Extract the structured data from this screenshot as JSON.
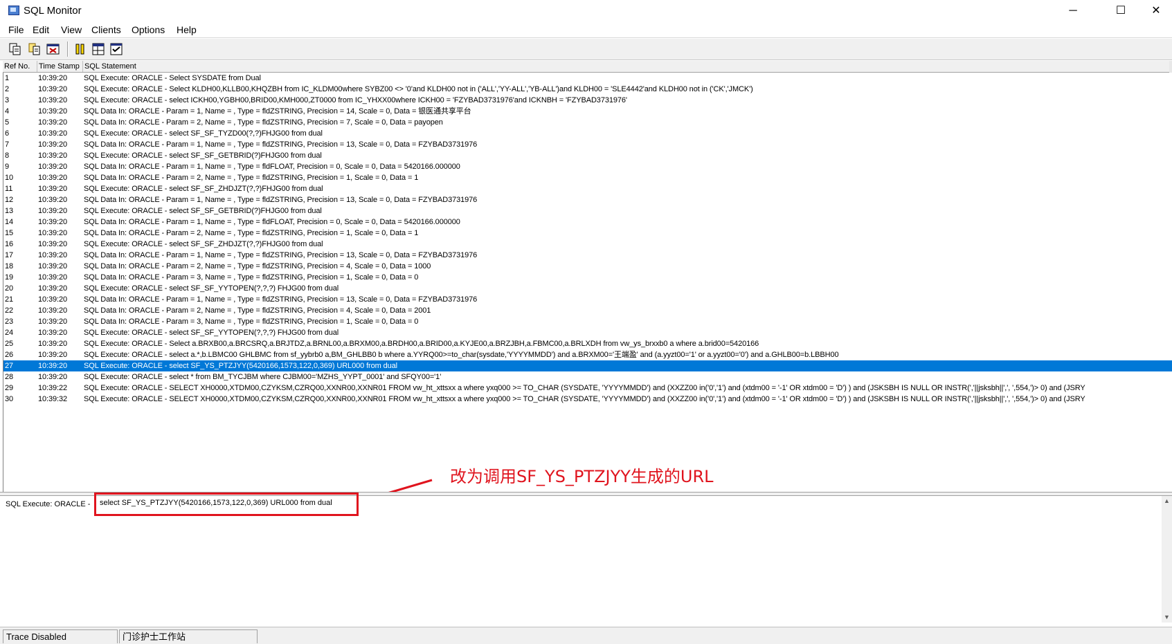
{
  "window": {
    "title": "SQL Monitor",
    "controls": {
      "minimize": "─",
      "maximize": "☐",
      "close": "✕"
    }
  },
  "menu": [
    {
      "label": "File"
    },
    {
      "label": "Edit"
    },
    {
      "label": "View"
    },
    {
      "label": "Clients"
    },
    {
      "label": "Options"
    },
    {
      "label": "Help"
    }
  ],
  "toolbar": {
    "buttons": [
      "save-log-icon",
      "copy-icon",
      "clear-icon",
      "pause-icon",
      "split-view-icon",
      "options-icon"
    ]
  },
  "columns": {
    "ref": "Ref No.",
    "time": "Time Stamp",
    "stmt": "SQL Statement"
  },
  "rows": [
    {
      "ref": "1",
      "time": "10:39:20",
      "stmt": "SQL Execute: ORACLE - Select SYSDATE from Dual"
    },
    {
      "ref": "2",
      "time": "10:39:20",
      "stmt": "SQL Execute: ORACLE - Select KLDH00,KLLB00,KHQZBH from IC_KLDM00where SYBZ00 <> '0'and KLDH00 not in ('ALL','YY-ALL','YB-ALL')and KLDH00 = 'SLE4442'and KLDH00 not in ('CK','JMCK')"
    },
    {
      "ref": "3",
      "time": "10:39:20",
      "stmt": "SQL Execute: ORACLE - select ICKH00,YGBH00,BRID00,KMH000,ZT0000 from IC_YHXX00where ICKH00 = 'FZYBAD3731976'and ICKNBH = 'FZYBAD3731976'"
    },
    {
      "ref": "4",
      "time": "10:39:20",
      "stmt": "SQL Data In: ORACLE - Param = 1, Name = , Type = fldZSTRING, Precision = 14, Scale = 0, Data = 银医通共享平台"
    },
    {
      "ref": "5",
      "time": "10:39:20",
      "stmt": "SQL Data In: ORACLE - Param = 2, Name = , Type = fldZSTRING, Precision = 7, Scale = 0, Data = payopen"
    },
    {
      "ref": "6",
      "time": "10:39:20",
      "stmt": "SQL Execute: ORACLE -  select SF_SF_TYZD00(?,?)FHJG00 from dual"
    },
    {
      "ref": "7",
      "time": "10:39:20",
      "stmt": "SQL Data In: ORACLE - Param = 1, Name = , Type = fldZSTRING, Precision = 13, Scale = 0, Data = FZYBAD3731976"
    },
    {
      "ref": "8",
      "time": "10:39:20",
      "stmt": "SQL Execute: ORACLE - select SF_SF_GETBRID(?)FHJG00  from dual"
    },
    {
      "ref": "9",
      "time": "10:39:20",
      "stmt": "SQL Data In: ORACLE - Param = 1, Name = , Type = fldFLOAT, Precision = 0, Scale = 0, Data = 5420166.000000"
    },
    {
      "ref": "10",
      "time": "10:39:20",
      "stmt": "SQL Data In: ORACLE - Param = 2, Name = , Type = fldZSTRING, Precision = 1, Scale = 0, Data = 1"
    },
    {
      "ref": "11",
      "time": "10:39:20",
      "stmt": "SQL Execute: ORACLE -  select SF_SF_ZHDJZT(?,?)FHJG00 from dual"
    },
    {
      "ref": "12",
      "time": "10:39:20",
      "stmt": "SQL Data In: ORACLE - Param = 1, Name = , Type = fldZSTRING, Precision = 13, Scale = 0, Data = FZYBAD3731976"
    },
    {
      "ref": "13",
      "time": "10:39:20",
      "stmt": "SQL Execute: ORACLE - select SF_SF_GETBRID(?)FHJG00  from dual"
    },
    {
      "ref": "14",
      "time": "10:39:20",
      "stmt": "SQL Data In: ORACLE - Param = 1, Name = , Type = fldFLOAT, Precision = 0, Scale = 0, Data = 5420166.000000"
    },
    {
      "ref": "15",
      "time": "10:39:20",
      "stmt": "SQL Data In: ORACLE - Param = 2, Name = , Type = fldZSTRING, Precision = 1, Scale = 0, Data = 1"
    },
    {
      "ref": "16",
      "time": "10:39:20",
      "stmt": "SQL Execute: ORACLE -  select SF_SF_ZHDJZT(?,?)FHJG00 from dual"
    },
    {
      "ref": "17",
      "time": "10:39:20",
      "stmt": "SQL Data In: ORACLE - Param = 1, Name = , Type = fldZSTRING, Precision = 13, Scale = 0, Data = FZYBAD3731976"
    },
    {
      "ref": "18",
      "time": "10:39:20",
      "stmt": "SQL Data In: ORACLE - Param = 2, Name = , Type = fldZSTRING, Precision = 4, Scale = 0, Data = 1000"
    },
    {
      "ref": "19",
      "time": "10:39:20",
      "stmt": "SQL Data In: ORACLE - Param = 3, Name = , Type = fldZSTRING, Precision = 1, Scale = 0, Data = 0"
    },
    {
      "ref": "20",
      "time": "10:39:20",
      "stmt": "SQL Execute: ORACLE -  select SF_SF_YYTOPEN(?,?,?) FHJG00 from dual"
    },
    {
      "ref": "21",
      "time": "10:39:20",
      "stmt": "SQL Data In: ORACLE - Param = 1, Name = , Type = fldZSTRING, Precision = 13, Scale = 0, Data = FZYBAD3731976"
    },
    {
      "ref": "22",
      "time": "10:39:20",
      "stmt": "SQL Data In: ORACLE - Param = 2, Name = , Type = fldZSTRING, Precision = 4, Scale = 0, Data = 2001"
    },
    {
      "ref": "23",
      "time": "10:39:20",
      "stmt": "SQL Data In: ORACLE - Param = 3, Name = , Type = fldZSTRING, Precision = 1, Scale = 0, Data = 0"
    },
    {
      "ref": "24",
      "time": "10:39:20",
      "stmt": "SQL Execute: ORACLE -  select SF_SF_YYTOPEN(?,?,?) FHJG00 from dual"
    },
    {
      "ref": "25",
      "time": "10:39:20",
      "stmt": "SQL Execute: ORACLE - Select a.BRXB00,a.BRCSRQ,a.BRJTDZ,a.BRNL00,a.BRXM00,a.BRDH00,a.BRID00,a.KYJE00,a.BRZJBH,a.FBMC00,a.BRLXDH  from vw_ys_brxxb0 a where a.brid00=5420166"
    },
    {
      "ref": "26",
      "time": "10:39:20",
      "stmt": "SQL Execute: ORACLE - select a.*,b.LBMC00 GHLBMC from sf_yybrb0 a,BM_GHLBB0 b  where a.YYRQ00>=to_char(sysdate,'YYYYMMDD') and a.BRXM00='王端盈' and (a.yyzt00='1' or a.yyzt00='0') and a.GHLB00=b.LBBH00"
    },
    {
      "ref": "27",
      "time": "10:39:20",
      "stmt": "SQL Execute: ORACLE - select SF_YS_PTZJYY(5420166,1573,122,0,369) URL000 from dual",
      "selected": true
    },
    {
      "ref": "28",
      "time": "10:39:20",
      "stmt": "SQL Execute: ORACLE - select * from BM_TYCJBM where CJBM00='MZHS_YYPT_0001' and SFQY00='1'"
    },
    {
      "ref": "29",
      "time": "10:39:22",
      "stmt": "SQL Execute: ORACLE - SELECT XH0000,XTDM00,CZYKSM,CZRQ00,XXNR00,XXNR01 FROM vw_ht_xttsxx a where yxq000 >= TO_CHAR (SYSDATE, 'YYYYMMDD') and (XXZZ00 in('0','1') and (xtdm00 = '-1' OR xtdm00 = 'D') ) and (JSKSBH IS NULL OR INSTR(','||jsksbh||',', ',554,')> 0) and (JSRY"
    },
    {
      "ref": "30",
      "time": "10:39:32",
      "stmt": "SQL Execute: ORACLE - SELECT XH0000,XTDM00,CZYKSM,CZRQ00,XXNR00,XXNR01 FROM vw_ht_xttsxx a where yxq000 >= TO_CHAR (SYSDATE, 'YYYYMMDD') and (XXZZ00 in('0','1') and (xtdm00 = '-1' OR xtdm00 = 'D') ) and (JSKSBH IS NULL OR INSTR(','||jsksbh||',', ',554,')> 0) and (JSRY"
    }
  ],
  "detail": {
    "prefix": "SQL Execute: ORACLE - ",
    "sql": "select SF_YS_PTZJYY(5420166,1573,122,0,369) URL000 from dual"
  },
  "annotation": {
    "text": "改为调用SF_YS_PTZJYY生成的URL",
    "color": "#e0141e"
  },
  "status": {
    "trace": "Trace Disabled",
    "station": "门诊护士工作站"
  },
  "colors": {
    "selection": "#0078d7"
  }
}
